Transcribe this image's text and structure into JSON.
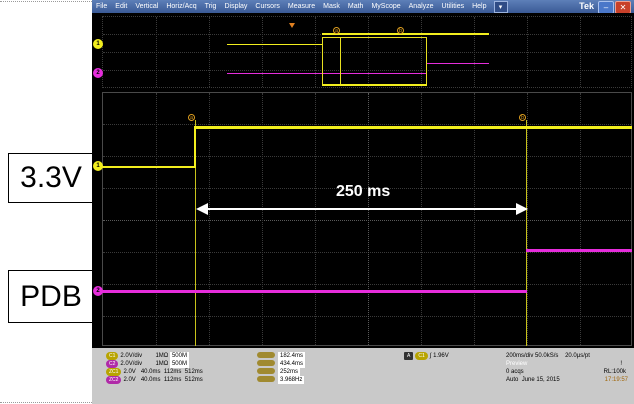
{
  "labels": {
    "v33": "3.3V",
    "pdb": "PDB"
  },
  "menu": [
    "File",
    "Edit",
    "Vertical",
    "Horiz/Acq",
    "Trig",
    "Display",
    "Cursors",
    "Measure",
    "Mask",
    "Math",
    "MyScope",
    "Analyze",
    "Utilities",
    "Help"
  ],
  "brand": "Tek",
  "annotation": {
    "duration": "250 ms"
  },
  "cursor_marks": {
    "a": "a",
    "b": "b"
  },
  "channel_markers": {
    "ch1": "1",
    "ch2": "2"
  },
  "readout": {
    "ch1": {
      "tag": "C1",
      "scale": "2.0V/div",
      "imp": "1MΩ",
      "bw": "500M"
    },
    "ch2": {
      "tag": "C2",
      "scale": "2.0V/div",
      "imp": "1MΩ",
      "bw": "500M"
    },
    "z1": {
      "tag": "ZC1",
      "v": "2.0V",
      "t1": "40.0ms",
      "t2": "112ms",
      "t3": "512ms"
    },
    "z2": {
      "tag": "ZC2",
      "v": "2.0V",
      "t1": "40.0ms",
      "t2": "112ms",
      "t3": "512ms"
    },
    "meas": [
      {
        "tag": "a",
        "value": "182.4ms"
      },
      {
        "tag": "b",
        "value": "434.4ms"
      },
      {
        "tag": "Δ",
        "value": "252ms"
      },
      {
        "tag": "1/Δ",
        "value": "3.968Hz"
      }
    ],
    "trigger": {
      "source": "A",
      "ch": "C1",
      "level": "1.96V"
    },
    "timebase": {
      "rate": "200ms/div",
      "sample": "50.0kS/s",
      "ptpt": "20.0μs/pt"
    },
    "status": {
      "mode": "Preview",
      "acqs": "0 acqs",
      "rl": "RL:100k",
      "auto": "Auto",
      "date": "June 15, 2015",
      "time": "17:19:57"
    }
  }
}
